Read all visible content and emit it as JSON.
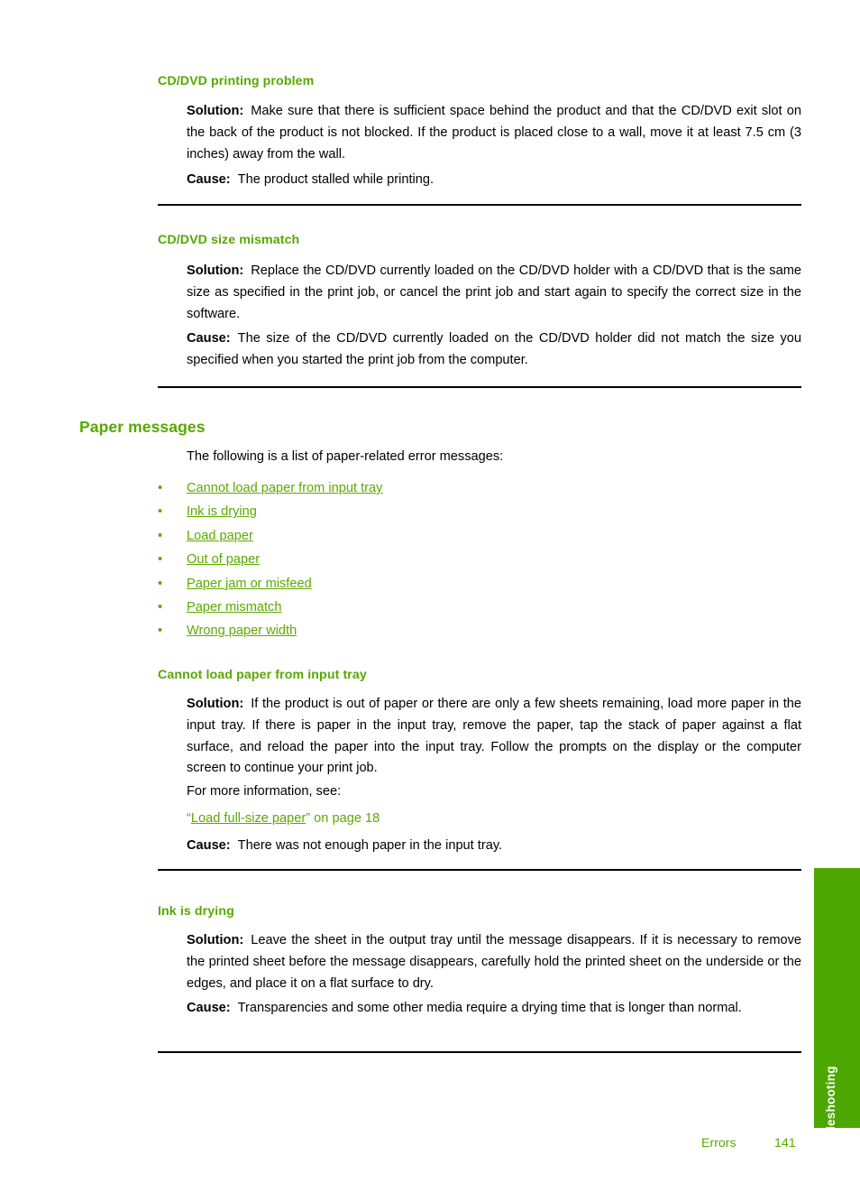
{
  "page": {
    "side_tab_label": "Troubleshooting",
    "footer_chapter": "Errors",
    "footer_page": "141",
    "accent_green": "#57a800",
    "link_green": "#5baa00",
    "tab_green": "#4ca800"
  },
  "sections": {
    "cd_dvd_printing_problem": {
      "heading": "CD/DVD printing problem",
      "solution_label": "Solution:",
      "solution_text": "Make sure that there is sufficient space behind the product and that the CD/DVD exit slot on the back of the product is not blocked. If the product is placed close to a wall, move it at least 7.5 cm (3 inches) away from the wall.",
      "cause_label": "Cause:",
      "cause_text": "The product stalled while printing."
    },
    "cd_dvd_size_mismatch": {
      "heading": "CD/DVD size mismatch",
      "solution_label": "Solution:",
      "solution_text": "Replace the CD/DVD currently loaded on the CD/DVD holder with a CD/DVD that is the same size as specified in the print job, or cancel the print job and start again to specify the correct size in the software.",
      "cause_label": "Cause:",
      "cause_text": "The size of the CD/DVD currently loaded on the CD/DVD holder did not match the size you specified when you started the print job from the computer."
    },
    "paper_messages": {
      "heading": "Paper messages",
      "intro": "The following is a list of paper-related error messages:",
      "bullet": "•",
      "links": [
        "Cannot load paper from input tray",
        "Ink is drying",
        "Load paper",
        "Out of paper",
        "Paper jam or misfeed",
        "Paper mismatch",
        "Wrong paper width"
      ]
    },
    "cannot_load_paper": {
      "heading": "Cannot load paper from input tray",
      "solution_label": "Solution:",
      "solution_text": "If the product is out of paper or there are only a few sheets remaining, load more paper in the input tray. If there is paper in the input tray, remove the paper, tap the stack of paper against a flat surface, and reload the paper into the input tray. Follow the prompts on the display or the computer screen to continue your print job.",
      "more_info": "For more information, see:",
      "xref_open_quote": "“",
      "xref_link": "Load full-size paper",
      "xref_close_quote": "”",
      "xref_suffix": " on page 18",
      "cause_label": "Cause:",
      "cause_text": "There was not enough paper in the input tray."
    },
    "ink_is_drying": {
      "heading": "Ink is drying",
      "solution_label": "Solution:",
      "solution_text": "Leave the sheet in the output tray until the message disappears. If it is necessary to remove the printed sheet before the message disappears, carefully hold the printed sheet on the underside or the edges, and place it on a flat surface to dry.",
      "cause_label": "Cause:",
      "cause_text": "Transparencies and some other media require a drying time that is longer than normal."
    }
  }
}
